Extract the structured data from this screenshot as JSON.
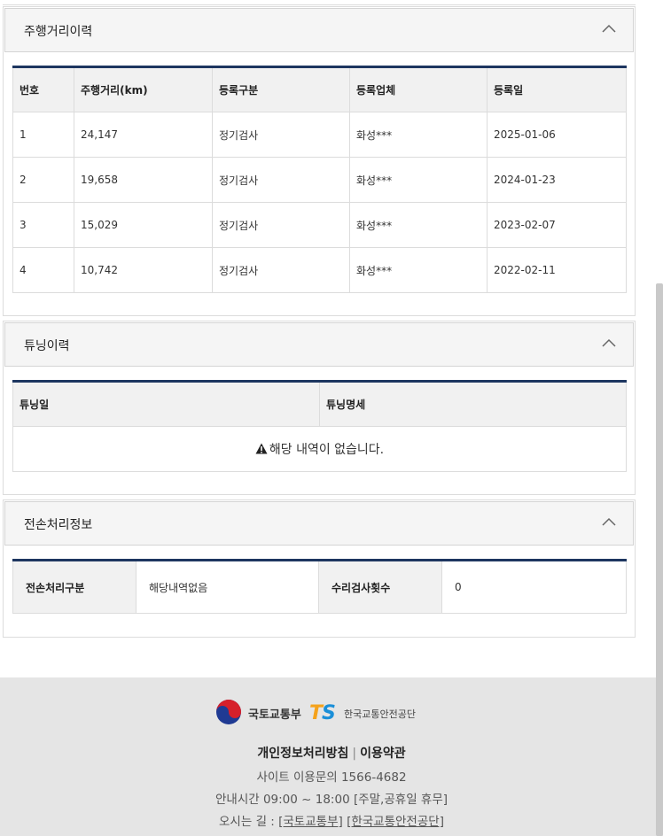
{
  "mileage": {
    "title": "주행거리이력",
    "headers": [
      "번호",
      "주행거리(km)",
      "등록구분",
      "등록업체",
      "등록일"
    ],
    "rows": [
      [
        "1",
        "24,147",
        "정기검사",
        "화성***",
        "2025-01-06"
      ],
      [
        "2",
        "19,658",
        "정기검사",
        "화성***",
        "2024-01-23"
      ],
      [
        "3",
        "15,029",
        "정기검사",
        "화성***",
        "2023-02-07"
      ],
      [
        "4",
        "10,742",
        "정기검사",
        "화성***",
        "2022-02-11"
      ]
    ]
  },
  "tuning": {
    "title": "튜닝이력",
    "headers": [
      "튜닝일",
      "튜닝명세"
    ],
    "empty_text": "해당 내역이 없습니다."
  },
  "total_loss": {
    "title": "전손처리정보",
    "label1": "전손처리구분",
    "value1": "해당내역없음",
    "label2": "수리검사횟수",
    "value2": "0"
  },
  "footer": {
    "ministry_name": "국토교통부",
    "ts_letters": [
      "T",
      "S"
    ],
    "agency_name": "한국교통안전공단",
    "privacy_link": "개인정보처리방침",
    "separator": "|",
    "terms_link": "이용약관",
    "phone_line": "사이트 이용문의 1566-4682",
    "hours_line": "안내시간 09:00 ~ 18:00 [주말,공휴일 휴무]",
    "directions_prefix": "오시는 길 : ",
    "directions_link1": "[국토교통부]",
    "directions_link2": "[한국교통안전공단]"
  },
  "colors": {
    "table_top_border": "#1d3660",
    "panel_head_bg": "#f5f5f5",
    "footer_bg": "#e5e5e5"
  }
}
